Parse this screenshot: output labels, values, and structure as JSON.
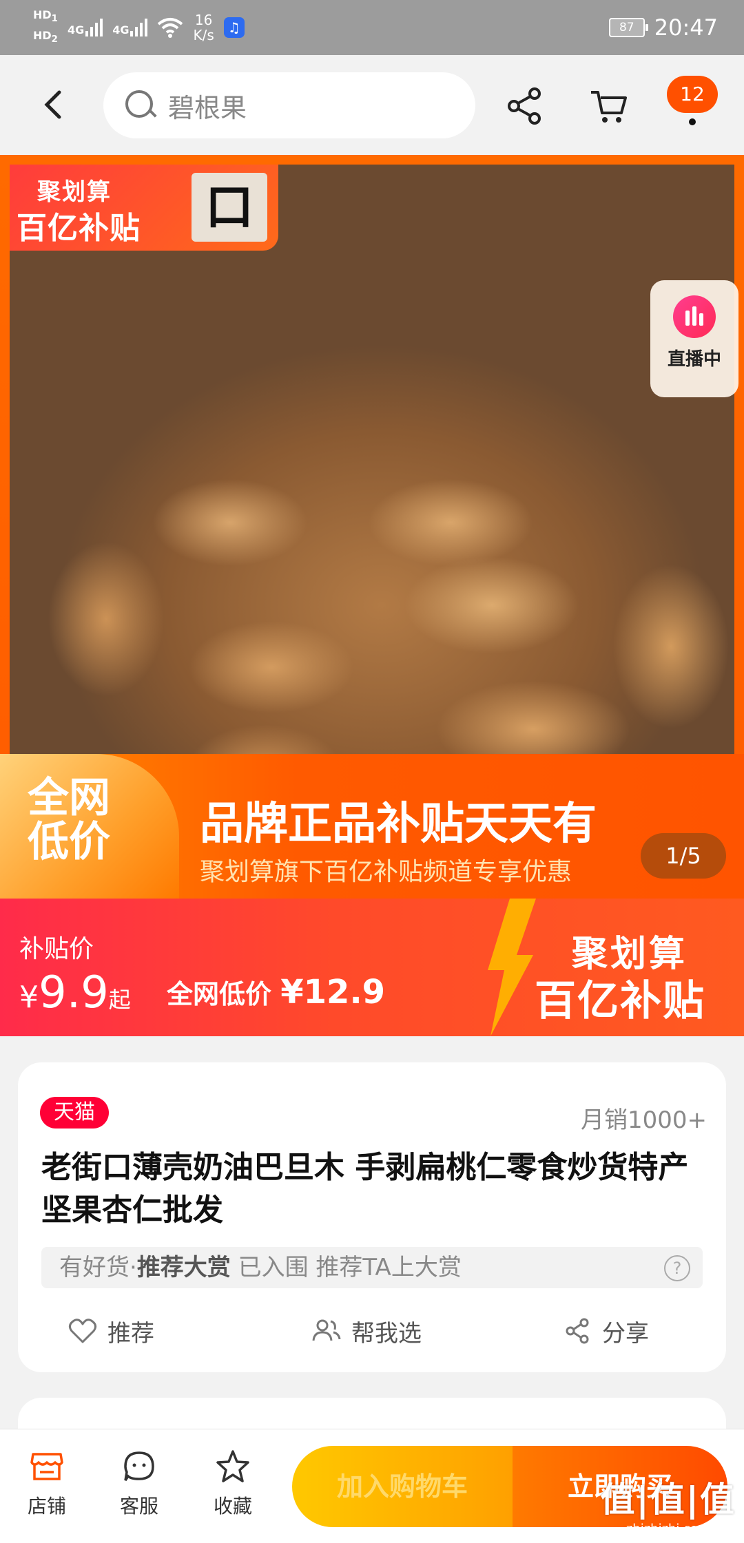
{
  "status_bar": {
    "hd1": "HD",
    "hd1_sub": "1",
    "hd2": "HD",
    "hd2_sub": "2",
    "net1": "4G",
    "net2": "4G",
    "speed_value": "16",
    "speed_unit": "K/s",
    "battery": "87",
    "time": "20:47"
  },
  "header": {
    "search_text": "碧根果",
    "cart_badge": "12"
  },
  "hero": {
    "corner_tag_line1": "聚划算",
    "corner_tag_line2": "百亿补贴",
    "logo_char": "口",
    "live_label": "直播中",
    "low_price_badge_line1": "全网",
    "low_price_badge_line2": "低价",
    "headline": "品牌正品补贴天天有",
    "subline": "聚划算旗下百亿补贴频道专享优惠",
    "pager": "1/5"
  },
  "price_strip": {
    "label": "补贴价",
    "currency": "¥",
    "price": "9.9",
    "suffix": "起",
    "compare_label": "全网低价",
    "compare_price": "¥12.9",
    "brand_line1": "聚划算",
    "brand_line2": "百亿补贴"
  },
  "product": {
    "platform_tag": "天猫",
    "monthly_sales": "月销1000+",
    "title": "老街口薄壳奶油巴旦木 手剥扁桃仁零食炒货特产坚果杏仁批发",
    "rec_prefix": "有好货·",
    "rec_bold": "推荐大赏",
    "rec_suffix": " 已入围 推荐TA上大赏",
    "rec_help": "?",
    "actions": [
      {
        "label": "推荐",
        "icon": "heart-icon"
      },
      {
        "label": "帮我选",
        "icon": "people-icon"
      },
      {
        "label": "分享",
        "icon": "share-icon"
      }
    ]
  },
  "bottom_bar": {
    "tabs": [
      {
        "label": "店铺",
        "icon": "store-icon"
      },
      {
        "label": "客服",
        "icon": "chat-bubble-icon"
      },
      {
        "label": "收藏",
        "icon": "star-icon"
      }
    ],
    "add_to_cart": "加入购物车",
    "buy_now": "立即购买"
  },
  "watermark": {
    "line1": "值|值|值",
    "line2": "zhizhizhi.com"
  },
  "colors": {
    "accent": "#ff5000",
    "tmall_red": "#ff0036",
    "price_red": "#ff2b4a",
    "cart_yellow": "#ffb400"
  }
}
